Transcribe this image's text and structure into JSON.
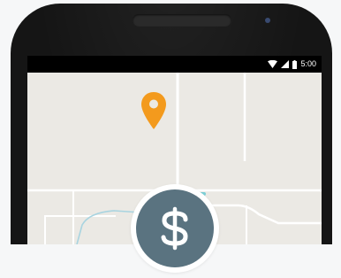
{
  "status_bar": {
    "time": "5:00",
    "icons": [
      "wifi-icon",
      "signal-icon",
      "battery-icon"
    ]
  },
  "map": {
    "pin": {
      "icon": "location-pin-icon",
      "color": "#f39a1d"
    }
  },
  "payment_badge": {
    "icon": "dollar-sign-icon",
    "color": "#5a7380"
  },
  "colors": {
    "device_body": "#151515",
    "map_background": "#ebe9e4",
    "map_roads": "#ffffff",
    "page_background": "#f6f7f8"
  }
}
